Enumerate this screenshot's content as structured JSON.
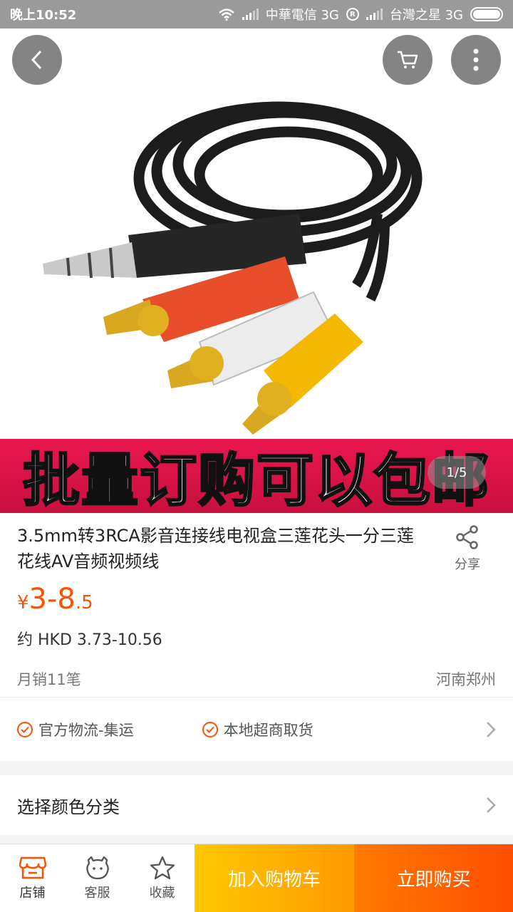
{
  "status_bar": {
    "time": "晚上10:52",
    "carrier1": "中華電信 3G",
    "carrier2": "台灣之星 3G",
    "badge": "R"
  },
  "hero": {
    "banner_text": "批量订购可以包邮",
    "pager": "1/5",
    "back_icon": "chevron-left-icon",
    "cart_icon": "cart-icon",
    "more_icon": "more-vertical-icon"
  },
  "product": {
    "title": "3.5mm转3RCA影音连接线电视盒三莲花头一分三莲花线AV音频视频线",
    "share_label": "分享",
    "price_currency": "¥",
    "price_main": "3-8",
    "price_decimal": ".5",
    "hkd_price": "约 HKD 3.73-10.56",
    "monthly_sales": "月销11笔",
    "location": "河南郑州"
  },
  "services": [
    {
      "label": "官方物流-集运"
    },
    {
      "label": "本地超商取货"
    }
  ],
  "options": {
    "choose_label": "选择颜色分类"
  },
  "bottom_bar": {
    "shop_label": "店铺",
    "service_label": "客服",
    "favorite_label": "收藏",
    "add_to_cart_label": "加入购物车",
    "buy_now_label": "立即购买"
  },
  "colors": {
    "accent": "#ff5000",
    "cart_button": "#ffb400",
    "buy_button": "#ff5a00",
    "banner": "#e8164f"
  }
}
